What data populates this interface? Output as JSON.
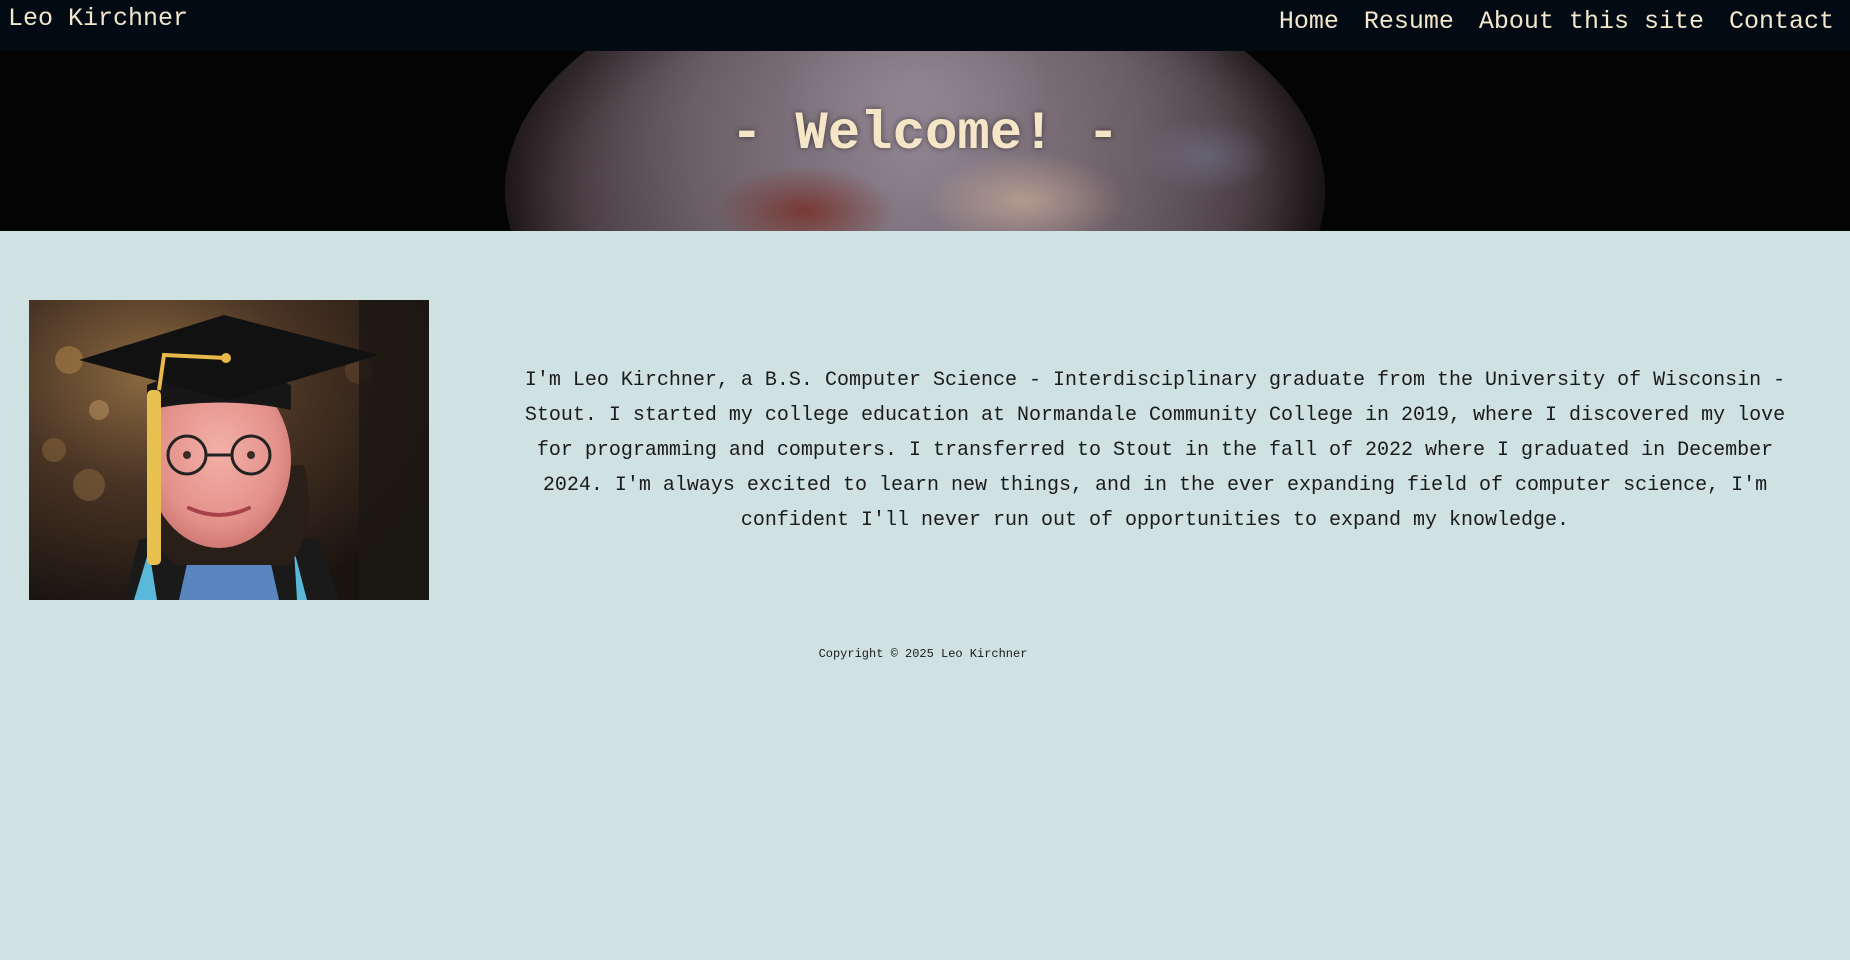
{
  "nav": {
    "brand": "Leo Kirchner",
    "links": [
      "Home",
      "Resume",
      "About this site",
      "Contact"
    ]
  },
  "hero": {
    "title": "- Welcome! -"
  },
  "main": {
    "photo_alt": "Leo Kirchner graduation photo",
    "bio": "I'm Leo Kirchner, a B.S. Computer Science - Interdisciplinary graduate from the University of Wisconsin - Stout. I started my college education at Normandale Community College in 2019, where I discovered my love for programming and computers. I transferred to Stout in the fall of 2022 where I graduated in December 2024. I'm always excited to learn new things, and in the ever expanding field of computer science, I'm confident I'll never run out of opportunities to expand my knowledge."
  },
  "footer": {
    "copyright": "Copyright © 2025 Leo Kirchner"
  },
  "colors": {
    "navbar_bg": "#020b13",
    "nav_text": "#f3e6cd",
    "page_bg": "#cfe1e0",
    "hero_title": "#f6e6c8"
  }
}
